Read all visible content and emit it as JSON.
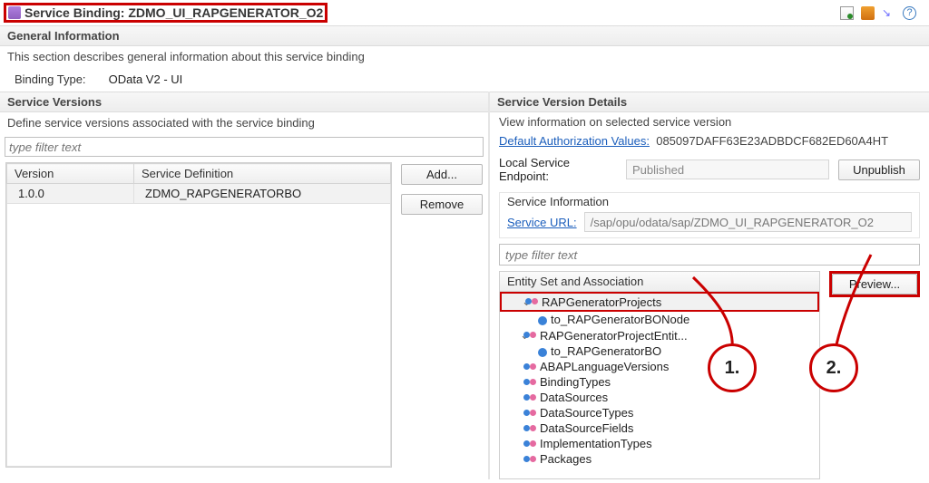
{
  "header": {
    "title": "Service Binding: ZDMO_UI_RAPGENERATOR_O2"
  },
  "general": {
    "section_title": "General Information",
    "subtitle": "This section describes general information about this service binding",
    "binding_type_label": "Binding Type:",
    "binding_type_value": "OData V2 - UI"
  },
  "versions": {
    "section_title": "Service Versions",
    "subtitle": "Define service versions associated with the service binding",
    "filter_placeholder": "type filter text",
    "col_version": "Version",
    "col_service_def": "Service Definition",
    "row_version": "1.0.0",
    "row_service_def": "ZDMO_RAPGENERATORBO",
    "btn_add": "Add...",
    "btn_remove": "Remove"
  },
  "details": {
    "section_title": "Service Version Details",
    "subtitle": "View information on selected service version",
    "default_auth_label": "Default Authorization Values:",
    "default_auth_value": "085097DAFF63E23ADBDCF682ED60A4HT",
    "local_endpoint_label": "Local Service Endpoint:",
    "local_endpoint_value": "Published",
    "btn_unpublish": "Unpublish",
    "service_info_title": "Service Information",
    "service_url_label": "Service URL:",
    "service_url_value": "/sap/opu/odata/sap/ZDMO_UI_RAPGENERATOR_O2",
    "entity_filter_placeholder": "type filter text",
    "entity_col_header": "Entity Set and Association",
    "btn_preview": "Preview...",
    "tree": [
      {
        "level": 1,
        "expand": "v",
        "icon": "double",
        "label": "RAPGeneratorProjects",
        "selected": true
      },
      {
        "level": 2,
        "expand": "",
        "icon": "single",
        "label": "to_RAPGeneratorBONode"
      },
      {
        "level": 1,
        "expand": "v",
        "icon": "double",
        "label": "RAPGeneratorProjectEntit..."
      },
      {
        "level": 2,
        "expand": "",
        "icon": "single",
        "label": "to_RAPGeneratorBO"
      },
      {
        "level": 1,
        "expand": "",
        "icon": "double",
        "label": "ABAPLanguageVersions"
      },
      {
        "level": 1,
        "expand": "",
        "icon": "double",
        "label": "BindingTypes"
      },
      {
        "level": 1,
        "expand": "",
        "icon": "double",
        "label": "DataSources"
      },
      {
        "level": 1,
        "expand": "",
        "icon": "double",
        "label": "DataSourceTypes"
      },
      {
        "level": 1,
        "expand": "",
        "icon": "double",
        "label": "DataSourceFields"
      },
      {
        "level": 1,
        "expand": "",
        "icon": "double",
        "label": "ImplementationTypes"
      },
      {
        "level": 1,
        "expand": "",
        "icon": "double",
        "label": "Packages"
      }
    ]
  },
  "callouts": {
    "one": "1.",
    "two": "2."
  }
}
